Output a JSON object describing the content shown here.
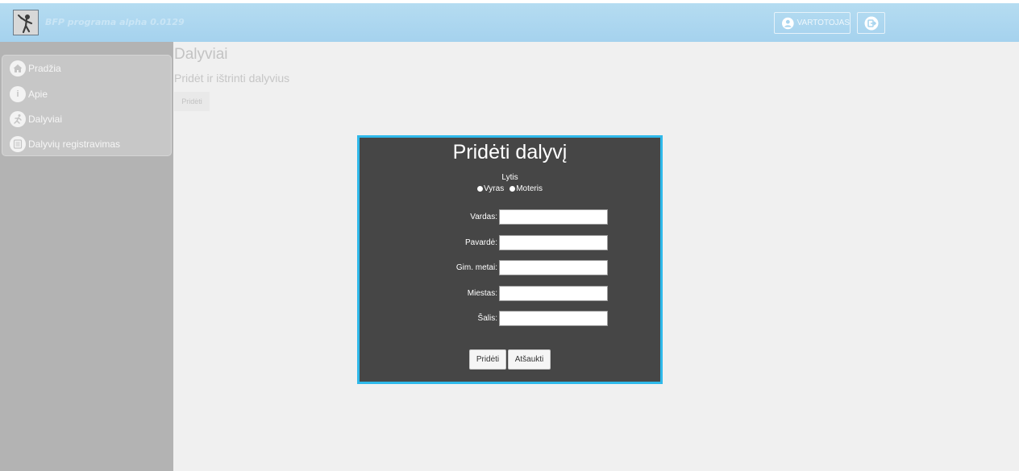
{
  "app": {
    "title": "BFP programa alpha 0.0129"
  },
  "header": {
    "user_label": "VARTOTOJAS",
    "user_icon": "user-icon",
    "logout_icon": "logout-icon"
  },
  "sidebar": {
    "items": [
      {
        "label": "Pradžia",
        "icon": "home-icon"
      },
      {
        "label": "Apie",
        "icon": "info-icon"
      },
      {
        "label": "Dalyviai",
        "icon": "runner-icon"
      },
      {
        "label": "Dalyvių registravimas",
        "icon": "list-icon"
      }
    ]
  },
  "main": {
    "title": "Dalyviai",
    "subtitle": "Pridėt ir ištrinti dalyvius",
    "add_label": "Pridėti"
  },
  "modal": {
    "title": "Pridėti dalyvį",
    "gender_label": "Lytis",
    "gender_options": [
      "Vyras",
      "Moteris"
    ],
    "fields": [
      {
        "label": "Vardas:",
        "value": ""
      },
      {
        "label": "Pavardė:",
        "value": ""
      },
      {
        "label": "Gim. metai:",
        "value": ""
      },
      {
        "label": "Miestas:",
        "value": ""
      },
      {
        "label": "Šalis:",
        "value": ""
      }
    ],
    "submit_label": "Pridėti",
    "cancel_label": "Atšaukti"
  },
  "colors": {
    "header": "#b3dbf1",
    "sidebar": "#b3b3b3",
    "modal_bg": "#464646",
    "modal_border": "#2fb9ea"
  }
}
